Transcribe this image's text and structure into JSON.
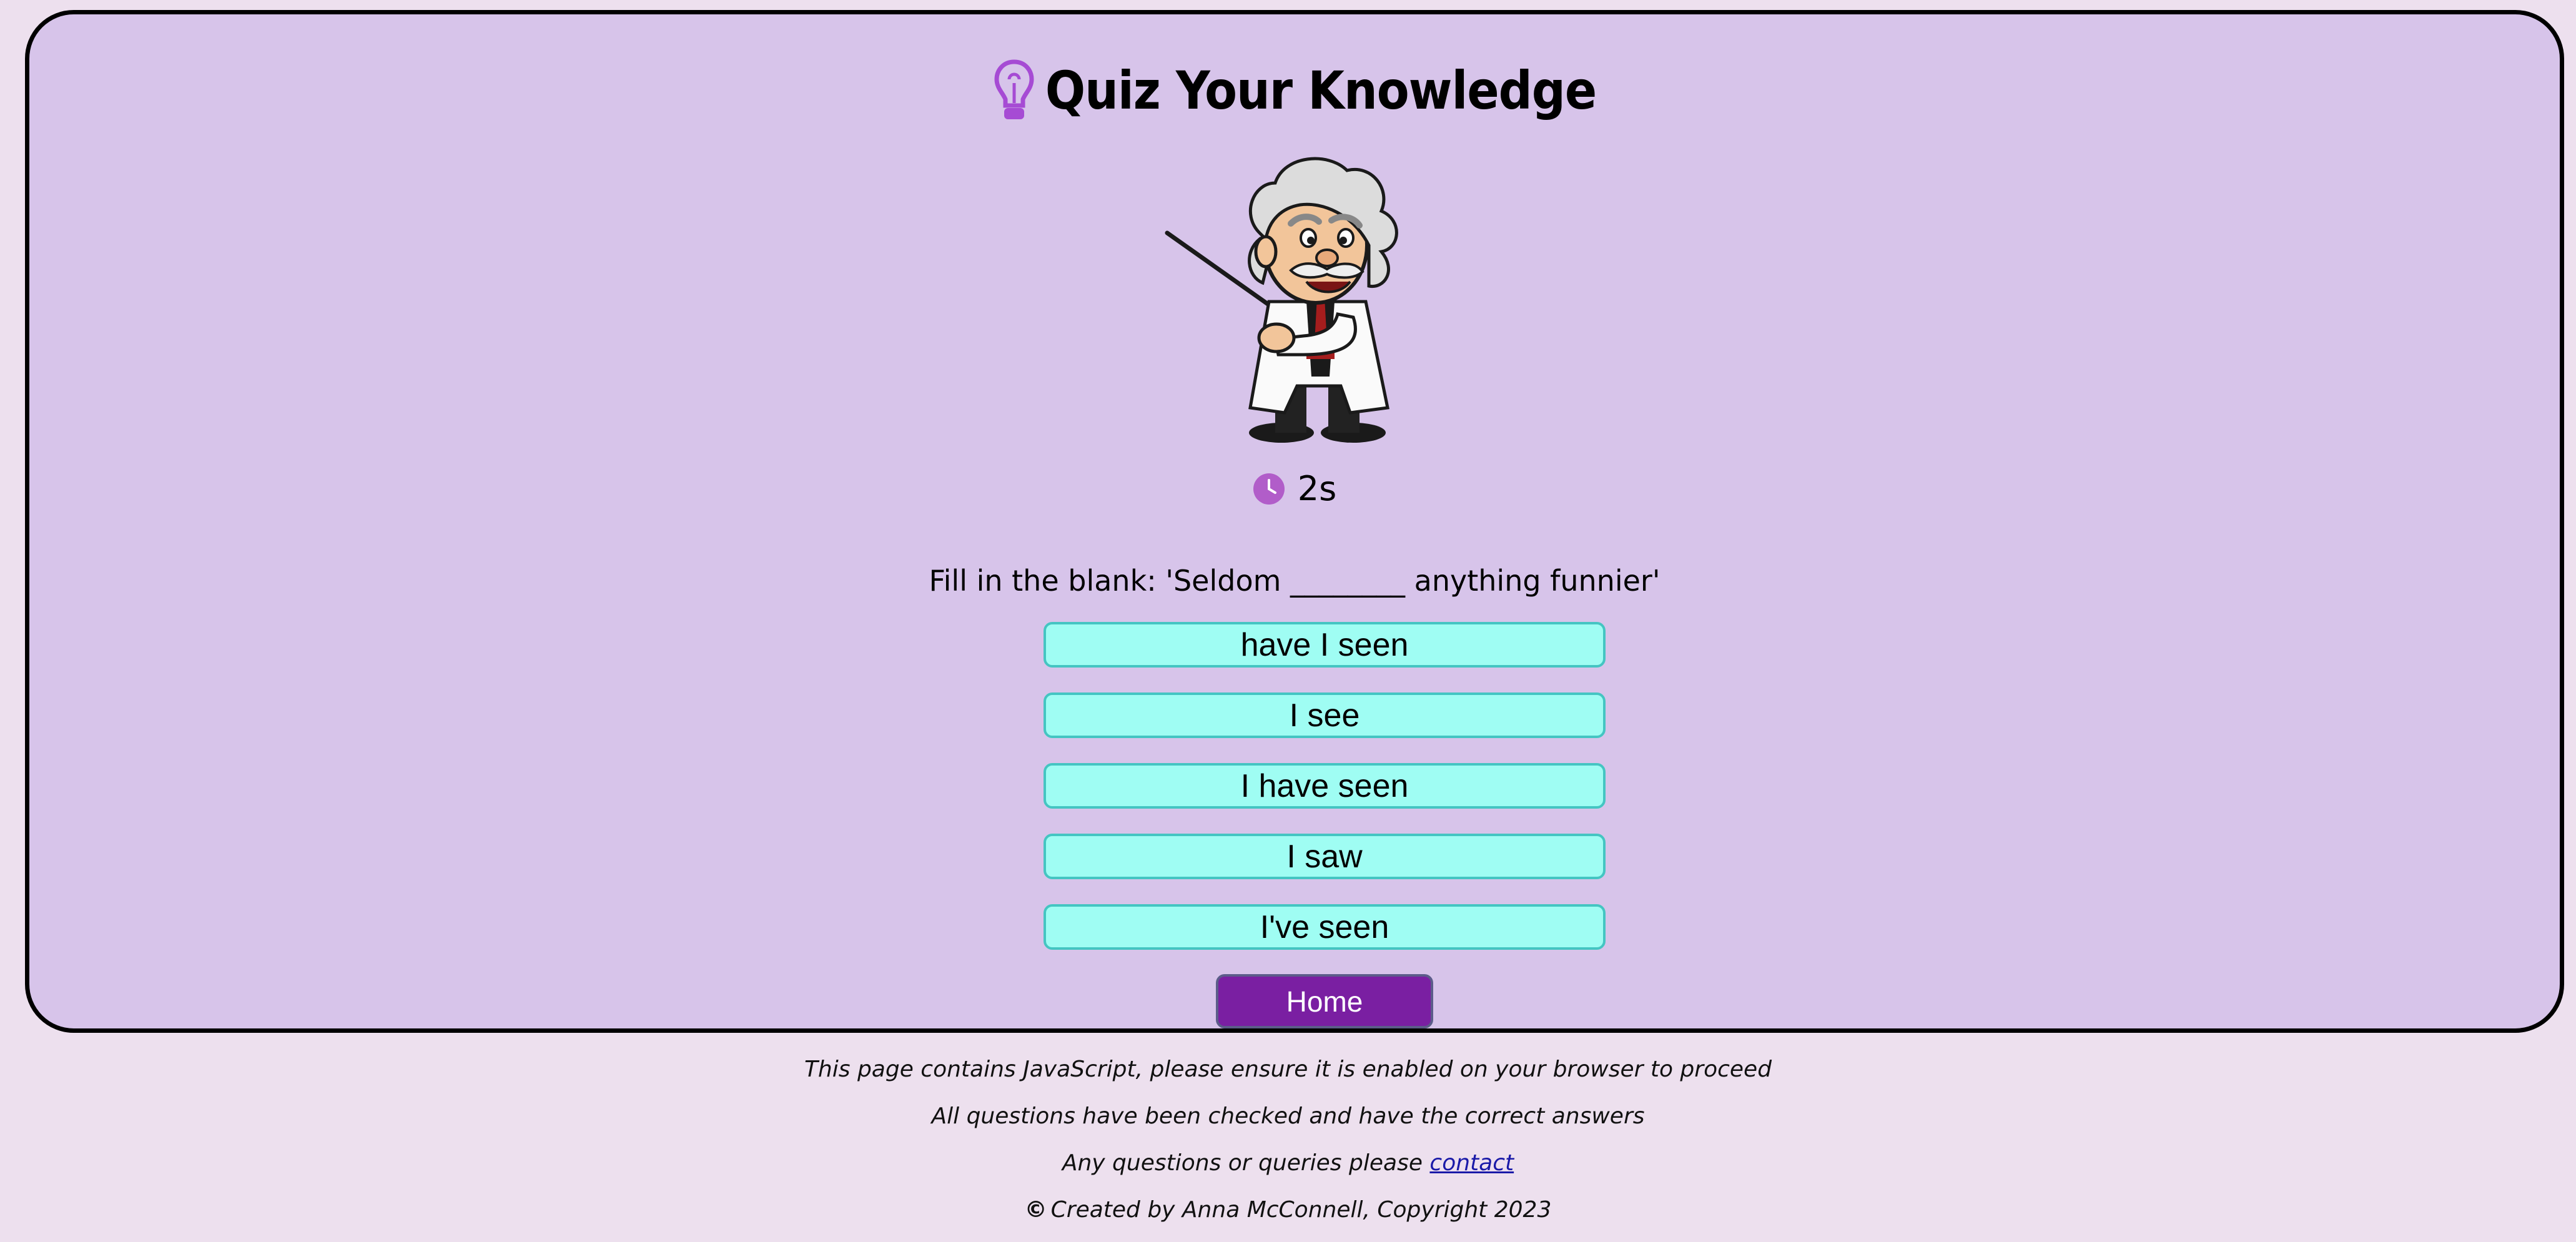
{
  "header": {
    "title": "Quiz Your Knowledge",
    "icon": "lightbulb-icon",
    "icon_color": "#a64bd4"
  },
  "mascot": {
    "icon": "professor-mascot"
  },
  "timer": {
    "icon": "clock-icon",
    "icon_color": "#b15dc9",
    "value": "2s"
  },
  "question": {
    "text": "Fill in the blank: 'Seldom ________ anything funnier'"
  },
  "answers": [
    {
      "label": "have I seen"
    },
    {
      "label": "I see"
    },
    {
      "label": "I have seen"
    },
    {
      "label": "I saw"
    },
    {
      "label": "I've seen"
    }
  ],
  "home_button": {
    "label": "Home",
    "color": "#7a1fa2"
  },
  "footer": {
    "line1": "This page contains JavaScript, please ensure it is enabled on your browser to proceed",
    "line2": "All questions have been checked and have the correct answers",
    "line3_prefix": "Any questions or queries please",
    "contact_link": "contact",
    "copyright_symbol": "©",
    "copyright": "Created by Anna McConnell, Copyright 2023"
  },
  "colors": {
    "page_bg": "#ede0ee",
    "card_bg": "#d7c4ea",
    "answer_bg": "#9ffdf3",
    "answer_border": "#44c5c2"
  }
}
